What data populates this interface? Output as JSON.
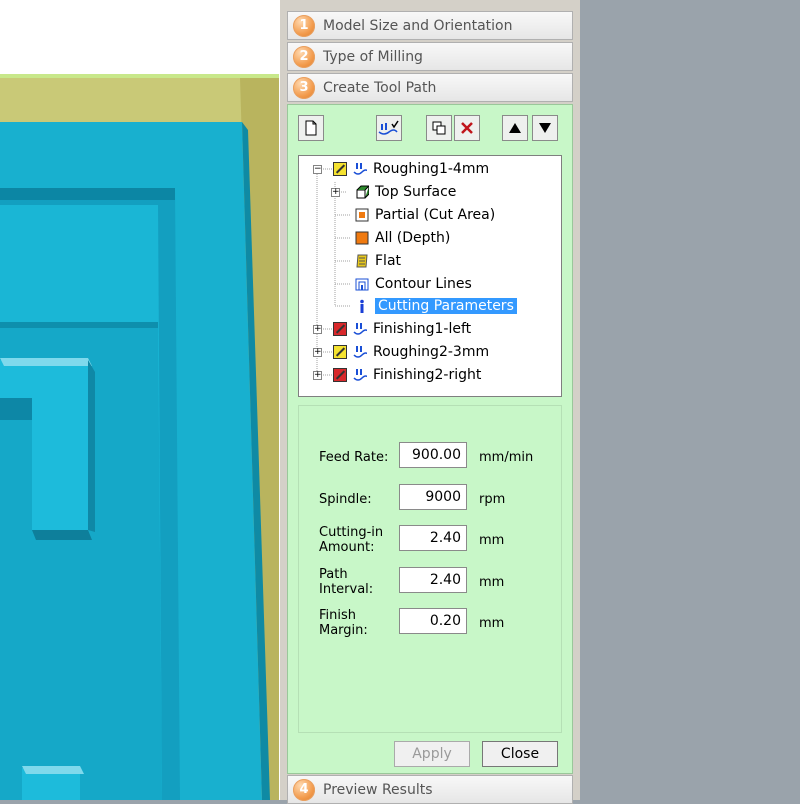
{
  "steps": [
    {
      "number": "1",
      "label": "Model Size and Orientation"
    },
    {
      "number": "2",
      "label": "Type of Milling"
    },
    {
      "number": "3",
      "label": "Create Tool Path"
    },
    {
      "number": "4",
      "label": "Preview Results"
    }
  ],
  "toolbar": {
    "buttons": [
      "new-icon",
      "tool-path-icon",
      "copy-icon",
      "delete-icon",
      "move-up-icon",
      "move-down-icon"
    ]
  },
  "tree": {
    "items": [
      {
        "label": "Roughing1-4mm",
        "icon": "roughing-yellow-icon"
      },
      {
        "label": "Top Surface",
        "icon": "cube-icon"
      },
      {
        "label": "Partial (Cut Area)",
        "icon": "partial-area-icon"
      },
      {
        "label": "All (Depth)",
        "icon": "depth-icon"
      },
      {
        "label": "Flat",
        "icon": "flat-icon"
      },
      {
        "label": "Contour Lines",
        "icon": "contour-icon"
      },
      {
        "label": "Cutting Parameters",
        "icon": "info-icon"
      },
      {
        "label": "Finishing1-left",
        "icon": "finishing-red-icon"
      },
      {
        "label": "Roughing2-3mm",
        "icon": "roughing-yellow-icon"
      },
      {
        "label": "Finishing2-right",
        "icon": "finishing-red-icon"
      }
    ],
    "expand_collapsed": "+",
    "expand_open": "−",
    "selected": "Cutting Parameters"
  },
  "params": {
    "feed_rate": {
      "label": "Feed Rate:",
      "value": "900.00",
      "unit": "mm/min"
    },
    "spindle": {
      "label": "Spindle:",
      "value": "9000",
      "unit": "rpm"
    },
    "cutting_in": {
      "label_line1": "Cutting-in",
      "label_line2": "Amount:",
      "value": "2.40",
      "unit": "mm"
    },
    "path_interval": {
      "label_line1": "Path",
      "label_line2": "Interval:",
      "value": "2.40",
      "unit": "mm"
    },
    "finish_margin": {
      "label_line1": "Finish",
      "label_line2": "Margin:",
      "value": "0.20",
      "unit": "mm"
    }
  },
  "buttons": {
    "apply": "Apply",
    "close": "Close"
  },
  "colors": {
    "model": "#1ab1cf",
    "panel_bg": "#c8f7c8",
    "step_badge": "#f29a4b",
    "selection": "#3399ff"
  }
}
